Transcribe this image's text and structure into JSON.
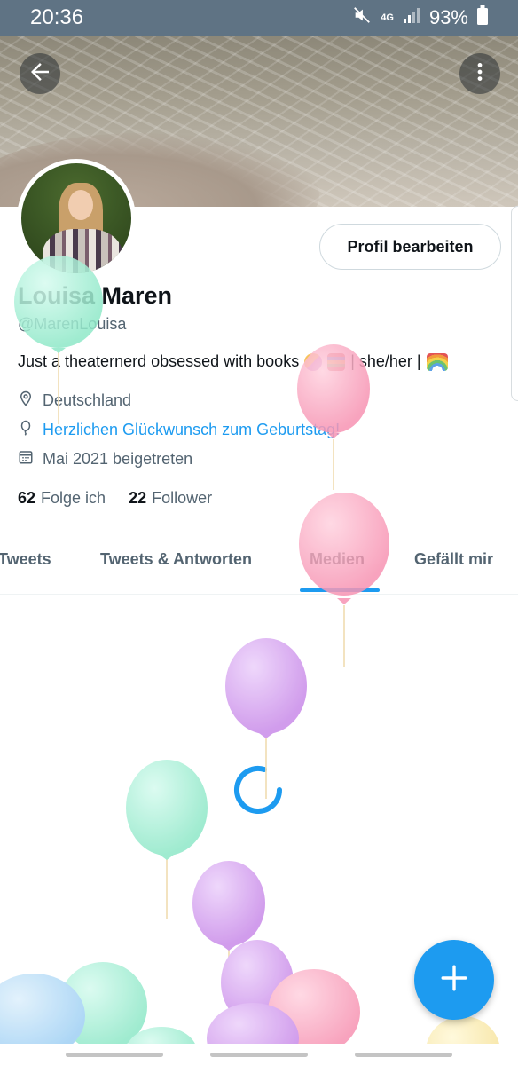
{
  "status_bar": {
    "time": "20:36",
    "network": "4G",
    "battery": "93%"
  },
  "header": {
    "back_icon": "arrow-left-icon",
    "more_icon": "more-vertical-icon"
  },
  "profile": {
    "edit_button": "Profil bearbeiten",
    "name": "Louisa Maren",
    "handle": "@MarenLouisa",
    "bio_text": "Just a theaternerd obsessed with books",
    "bio_suffix": "| she/her |",
    "location": "Deutschland",
    "birthday": "Herzlichen Glückwunsch zum Geburtstag!",
    "joined": "Mai 2021 beigetreten",
    "following_count": "62",
    "following_label": "Folge ich",
    "followers_count": "22",
    "followers_label": "Follower"
  },
  "tabs": [
    {
      "label": "Tweets",
      "active": false
    },
    {
      "label": "Tweets & Antworten",
      "active": false
    },
    {
      "label": "Medien",
      "active": true
    },
    {
      "label": "Gefällt mir",
      "active": false
    }
  ],
  "colors": {
    "accent": "#1d9bf0",
    "status_bar": "#5f7384",
    "balloon_green": "#a9f0d6",
    "balloon_pink": "#f9a9c2",
    "balloon_purple": "#d7a6f0",
    "balloon_blue": "#b9ddf7"
  }
}
